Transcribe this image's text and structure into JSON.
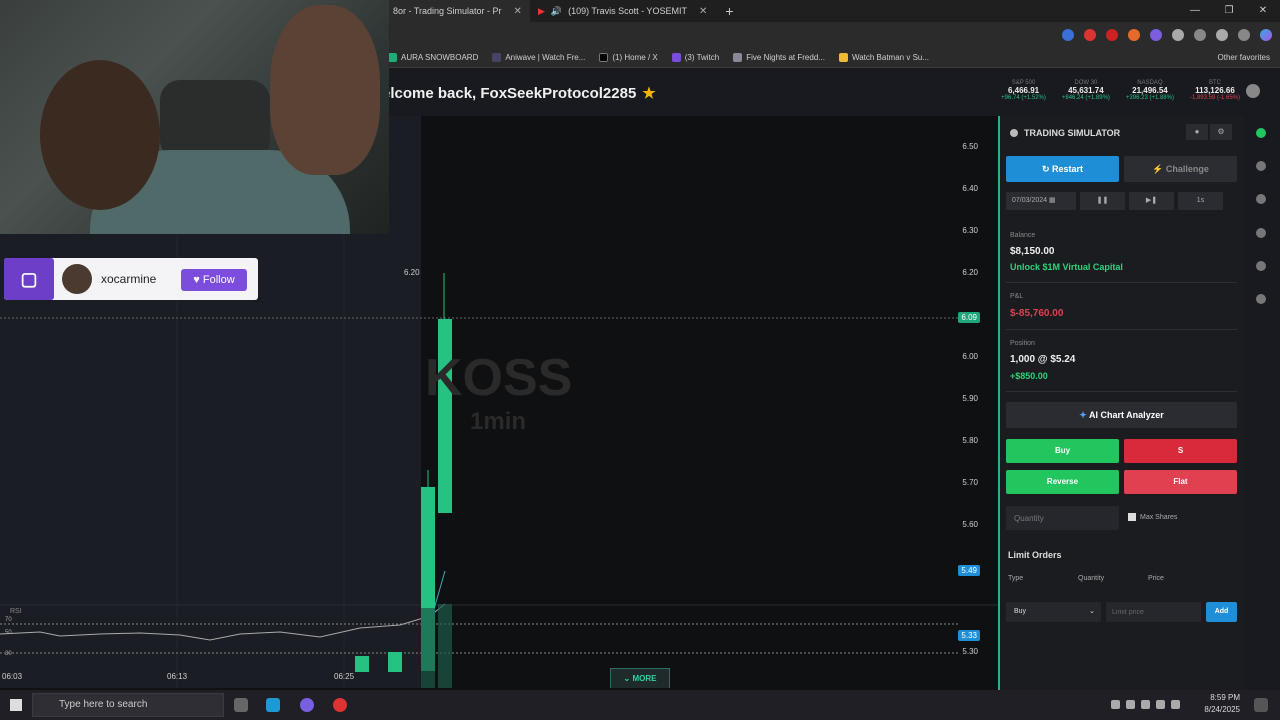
{
  "browser": {
    "tabs": [
      {
        "label": "8or - Trading Simulator - Pr",
        "active": true
      },
      {
        "label": "(109) Travis Scott - YOSEMIT",
        "active": false
      }
    ],
    "new_tab": "+",
    "window_controls": [
      "—",
      "❐",
      "✕"
    ],
    "favorites": [
      "AURA SNOWBOARD",
      "Aniwave | Watch Fre...",
      "(1) Home / X",
      "(3) Twitch",
      "Five Nights at Fredd...",
      "Watch Batman v Su..."
    ],
    "other_favorites": "Other favorites"
  },
  "header": {
    "welcome": "elcome back, FoxSeekProtocol2285",
    "star": "★",
    "tickers": [
      {
        "name": "S&P 500",
        "value": "6,466.91",
        "change": "+96.74 (+1.52%)",
        "neg": false
      },
      {
        "name": "DOW 30",
        "value": "45,631.74",
        "change": "+846.24 (+1.89%)",
        "neg": false
      },
      {
        "name": "NASDAQ",
        "value": "21,496.54",
        "change": "+396.23 (+1.88%)",
        "neg": false
      },
      {
        "name": "BTC",
        "value": "113,126.66",
        "change": "-1,893.59 (-1.65%)",
        "neg": true
      }
    ]
  },
  "chart": {
    "symbol": "KOSS",
    "interval": "1min",
    "y_labels": [
      "6.50",
      "6.40",
      "6.30",
      "6.20",
      "6.00",
      "5.90",
      "5.80",
      "5.70",
      "5.60",
      "5.30"
    ],
    "price_tags": [
      {
        "text": "6.09",
        "color": "#1fa67a"
      },
      {
        "text": "5.49",
        "color": "#1e8fd6"
      },
      {
        "text": "5.33",
        "color": "#1e8fd6"
      }
    ],
    "high_label": "6.20",
    "rsi_label": "RSI",
    "rsi_levels": [
      "70",
      "50",
      "30"
    ],
    "x_labels": [
      "06:03",
      "06:13",
      "06:25"
    ],
    "more": "MORE"
  },
  "panel": {
    "title": "TRADING SIMULATOR",
    "restart": "Restart",
    "challenge": "Challenge",
    "date": "07/03/2024",
    "speed": "1s",
    "balance_label": "Balance",
    "balance": "$8,150.00",
    "unlock": "Unlock $1M Virtual Capital",
    "pnl_label": "P&L",
    "pnl": "$-85,760.00",
    "position_label": "Position",
    "position": "1,000 @ $5.24",
    "position_pnl": "+$850.00",
    "ai": "AI Chart Analyzer",
    "buy": "Buy",
    "sell": "S",
    "reverse": "Reverse",
    "flat": "Flat",
    "quantity_placeholder": "Quantity",
    "max_shares": "Max Shares",
    "limit_title": "Limit Orders",
    "limit_cols": [
      "Type",
      "Quantity",
      "Price"
    ],
    "limit_type": "Buy",
    "limit_price_placeholder": "Limit price",
    "add": "Add"
  },
  "twitch": {
    "username": "xocarmine",
    "follow": "Follow"
  },
  "taskbar": {
    "search": "Type here to search",
    "time": "8:59 PM",
    "date": "8/24/2025"
  },
  "colors": {
    "accent_green": "#22c55e",
    "accent_red": "#d92a3c",
    "accent_blue": "#1e8fd6",
    "twitch_purple": "#6d3fc9"
  },
  "chart_data": {
    "type": "candlestick",
    "xlabels": [
      "06:03",
      "06:13",
      "06:25"
    ]
  }
}
